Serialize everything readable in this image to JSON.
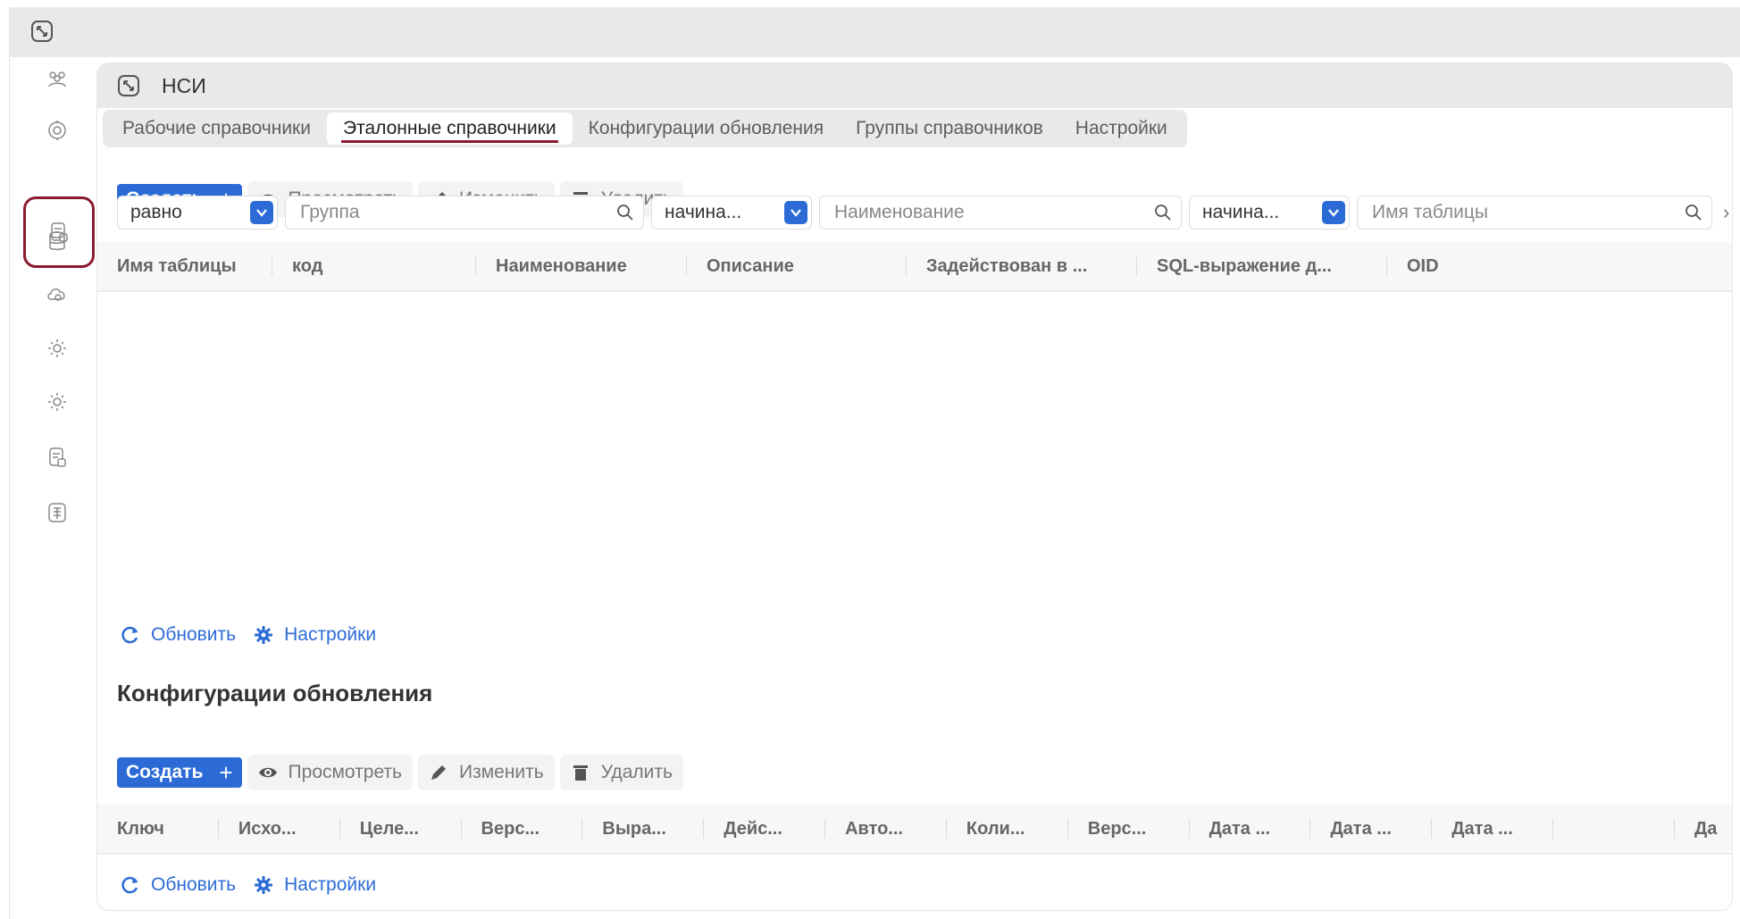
{
  "app": {
    "icon": "expand-icon"
  },
  "sidebar": {
    "items": [
      {
        "icon": "users-icon"
      },
      {
        "icon": "badge-icon"
      },
      {
        "icon": "reference-book-icon",
        "active": true
      },
      {
        "icon": "database-icon"
      },
      {
        "icon": "cloud-gear-icon"
      },
      {
        "icon": "settings-icon"
      },
      {
        "icon": "settings-alt-icon"
      },
      {
        "icon": "reference-book-alt-icon"
      },
      {
        "icon": "document-table-icon"
      }
    ]
  },
  "panel": {
    "title": "НСИ",
    "tabs": [
      {
        "label": "Рабочие справочники"
      },
      {
        "label": "Эталонные справочники",
        "active": true
      },
      {
        "label": "Конфигурации обновления"
      },
      {
        "label": "Группы справочников"
      },
      {
        "label": "Настройки"
      }
    ]
  },
  "toolbar": {
    "create": "Создать",
    "view": "Просмотреть",
    "edit": "Изменить",
    "delete": "Удалить"
  },
  "filters": {
    "op1": "равно",
    "field1_placeholder": "Группа",
    "op2": "начина...",
    "field2_placeholder": "Наименование",
    "op3": "начина...",
    "field3_placeholder": "Имя таблицы"
  },
  "table1": {
    "columns": [
      "Имя таблицы",
      "код",
      "Наименование",
      "Описание",
      "Задействован в ...",
      "SQL-выражение д...",
      "OID"
    ]
  },
  "actions": {
    "refresh": "Обновить",
    "settings": "Настройки"
  },
  "section2": {
    "title": "Конфигурации обновления"
  },
  "table2": {
    "columns": [
      "Ключ",
      "Исхо...",
      "Целе...",
      "Верс...",
      "Выра...",
      "Дейс...",
      "Авто...",
      "Коли...",
      "Верс...",
      "Дата ...",
      "Дата ...",
      "Дата ...",
      "",
      "Да"
    ]
  },
  "colors": {
    "accent": "#2c6bd6",
    "active_marker": "#8a1b2e",
    "header_bg": "#e9e9ea"
  }
}
